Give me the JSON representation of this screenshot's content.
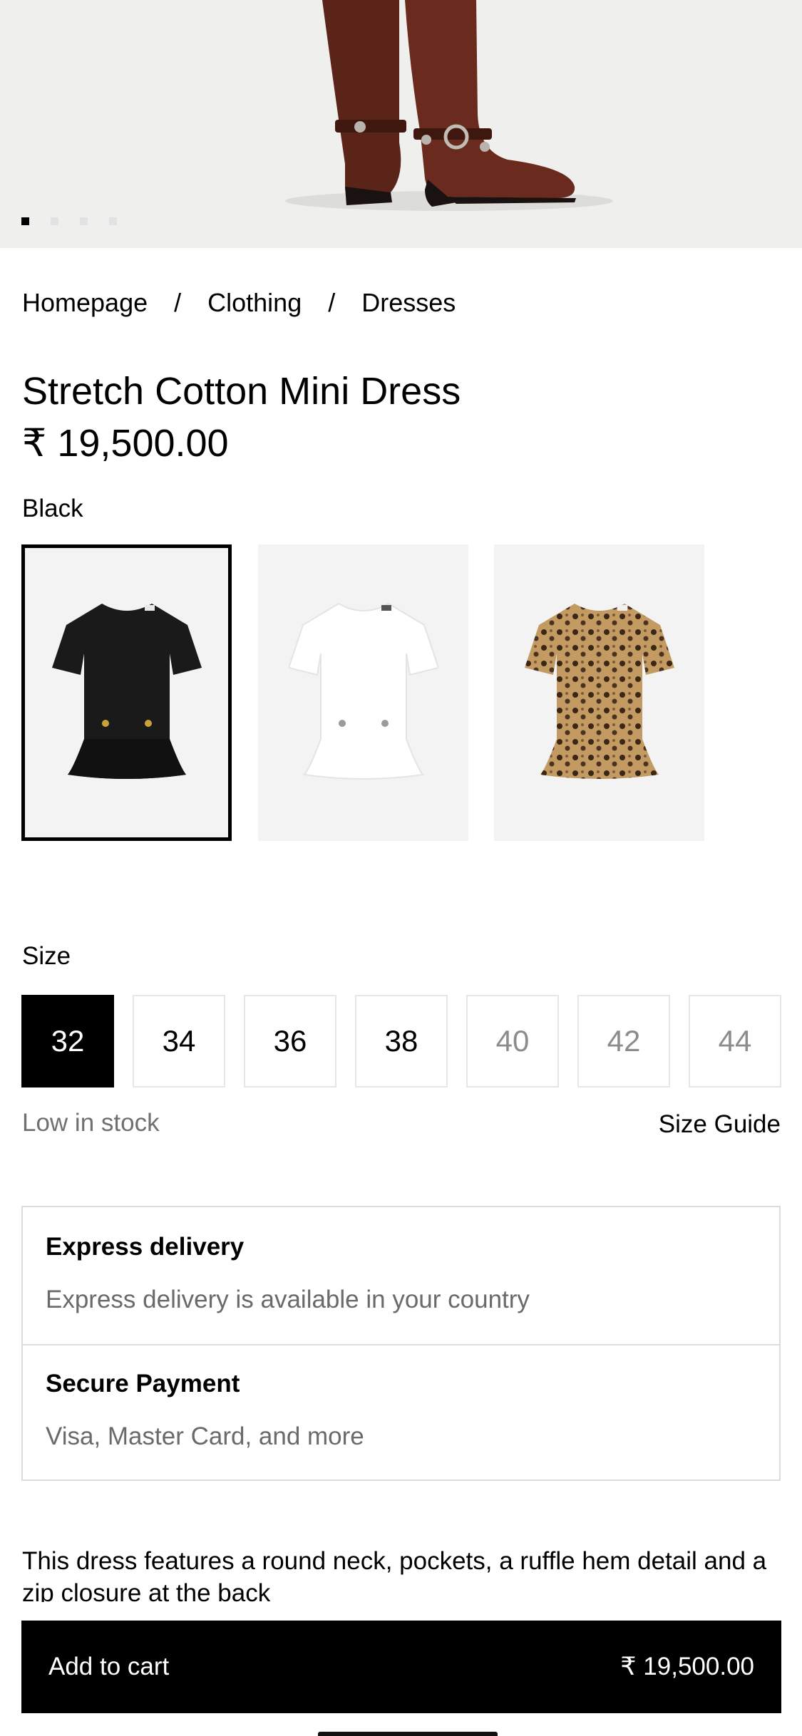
{
  "hero": {
    "image": "boots-product-photo",
    "carousel_count": 4,
    "carousel_active_index": 0
  },
  "breadcrumb": {
    "items": [
      "Homepage",
      "Clothing",
      "Dresses"
    ],
    "separator": "/"
  },
  "product": {
    "title": "Stretch Cotton Mini Dress",
    "price": "₹ 19,500.00",
    "selected_color": "Black"
  },
  "swatches": [
    {
      "name": "black-dress-swatch",
      "color": "#1a1a1a",
      "selected": true
    },
    {
      "name": "white-dress-swatch",
      "color": "#ffffff",
      "selected": false
    },
    {
      "name": "leopard-dress-swatch",
      "color": "#b08a55",
      "selected": false
    }
  ],
  "size": {
    "label": "Size",
    "options": [
      "32",
      "34",
      "36",
      "38",
      "40",
      "42",
      "44"
    ],
    "selected": "32",
    "unavailable": [
      "40",
      "42",
      "44"
    ],
    "stock_status": "Low in stock",
    "guide_label": "Size Guide"
  },
  "info": {
    "delivery_title": "Express delivery",
    "delivery_desc": "Express delivery is available in your country",
    "payment_title": "Secure Payment",
    "payment_desc": "Visa, Master Card, and more"
  },
  "description": "This dress features a round neck, pockets, a ruffle hem detail and a zip closure at the back",
  "cart": {
    "label": "Add to cart",
    "price": "₹ 19,500.00"
  },
  "colors": {
    "accent": "#000000",
    "muted_text": "#707070",
    "border": "#dcdcdc"
  }
}
